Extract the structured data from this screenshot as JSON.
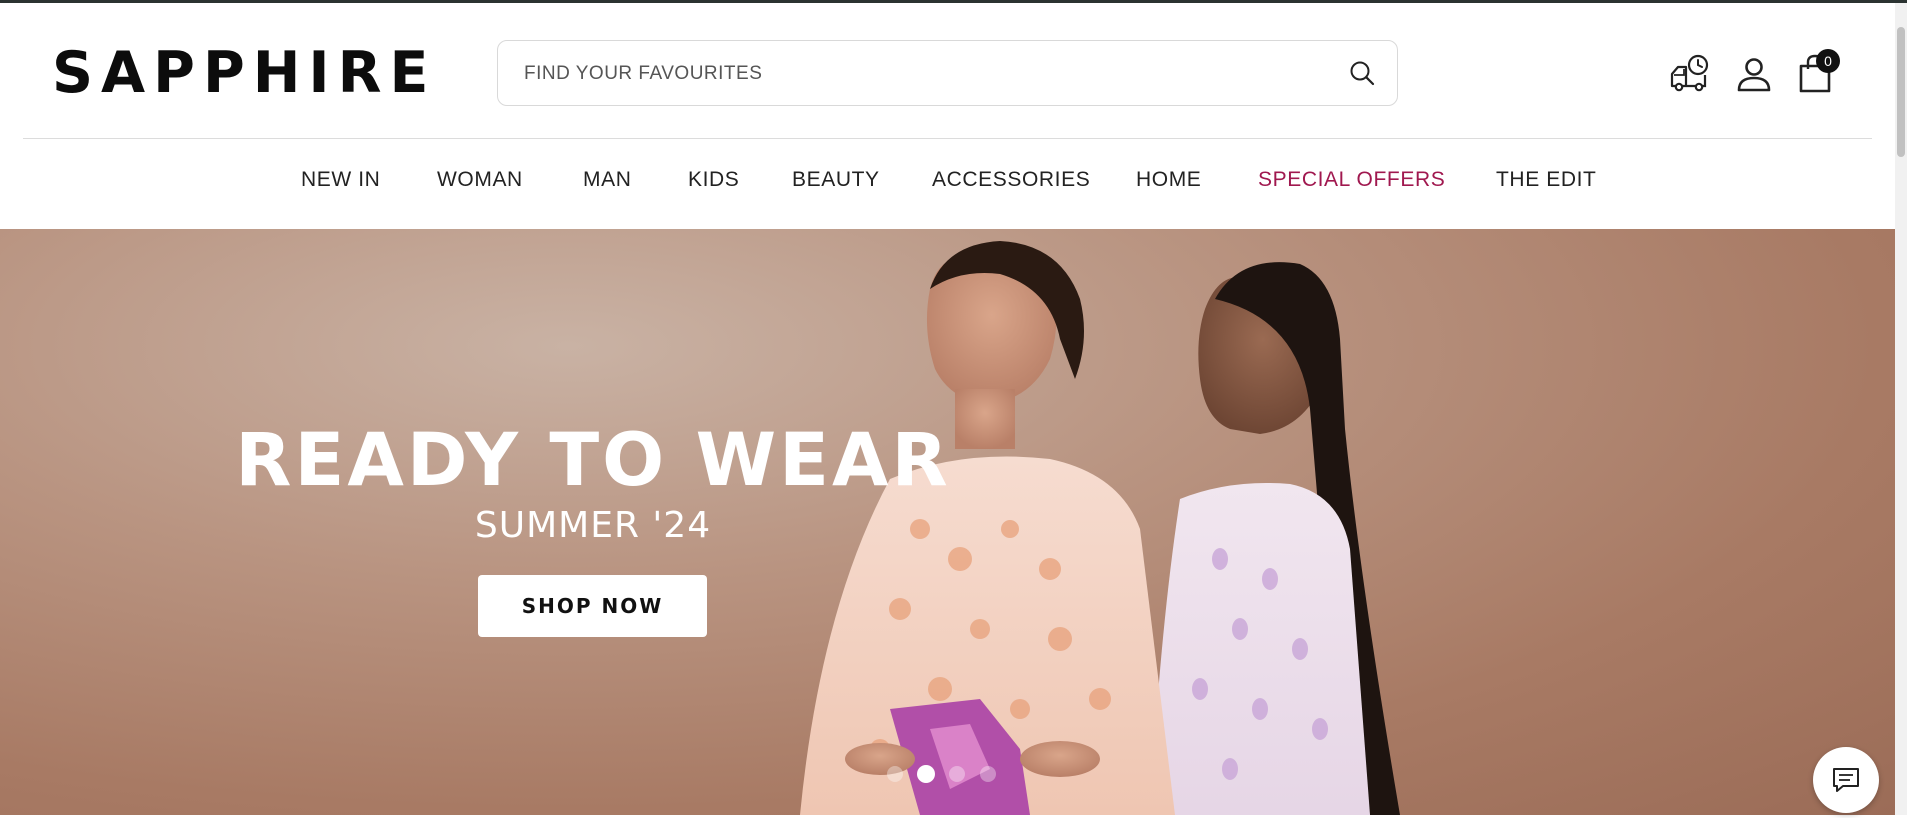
{
  "brand": {
    "logo_text": "SAPPHIRE"
  },
  "search": {
    "placeholder": "FIND YOUR FAVOURITES",
    "value": ""
  },
  "header_icons": {
    "track_order": "delivery-truck-clock-icon",
    "account": "user-icon",
    "cart": "shopping-bag-icon"
  },
  "cart": {
    "count": "0"
  },
  "nav": {
    "items": [
      {
        "label": "NEW IN",
        "color": "#222222"
      },
      {
        "label": "WOMAN",
        "color": "#222222"
      },
      {
        "label": "MAN",
        "color": "#222222"
      },
      {
        "label": "KIDS",
        "color": "#222222"
      },
      {
        "label": "BEAUTY",
        "color": "#222222"
      },
      {
        "label": "ACCESSORIES",
        "color": "#222222"
      },
      {
        "label": "HOME",
        "color": "#222222"
      },
      {
        "label": "SPECIAL OFFERS",
        "color": "#a0184f"
      },
      {
        "label": "THE EDIT",
        "color": "#222222"
      }
    ]
  },
  "hero": {
    "title": "READY TO WEAR",
    "subtitle": "SUMMER '24",
    "cta_label": "SHOP NOW",
    "carousel": {
      "slide_count": 4,
      "active_index": 1
    }
  },
  "chat": {
    "icon": "chat-message-icon"
  },
  "colors": {
    "accent": "#a0184f",
    "text": "#222222",
    "hero_bg": "#b99481"
  }
}
